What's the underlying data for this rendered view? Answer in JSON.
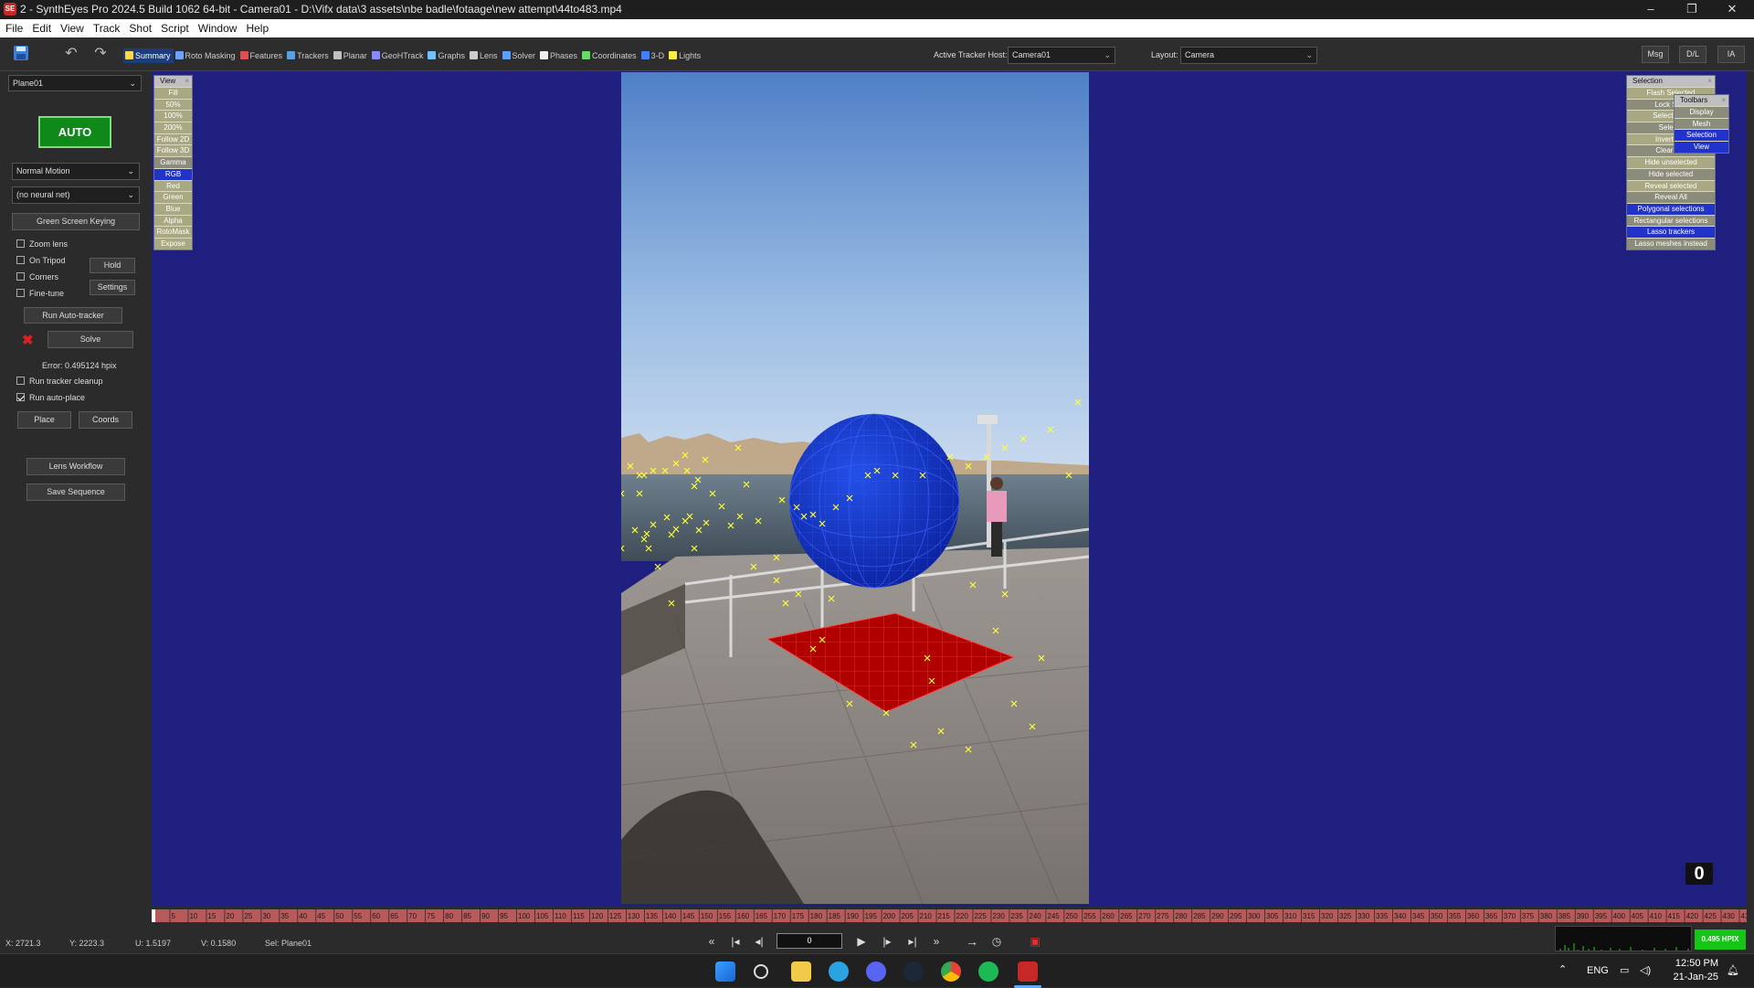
{
  "window": {
    "title": "2 - SynthEyes Pro 2024.5 Build 1062 64-bit - Camera01 - D:\\Vifx data\\3 assets\\nbe badle\\fotaage\\new attempt\\44to483.mp4",
    "app_icon_text": "SE",
    "controls": {
      "minimize": "–",
      "maximize": "❐",
      "close": "✕"
    }
  },
  "menu": [
    "File",
    "Edit",
    "View",
    "Track",
    "Shot",
    "Script",
    "Window",
    "Help"
  ],
  "toolbar": {
    "rooms": [
      {
        "label": "Summary",
        "color": "#ffd84a",
        "active": true
      },
      {
        "label": "Roto Masking",
        "color": "#6ea0ff"
      },
      {
        "label": "Features",
        "color": "#e05050"
      },
      {
        "label": "Trackers",
        "color": "#58a0e0"
      },
      {
        "label": "Planar",
        "color": "#c0c0c0"
      },
      {
        "label": "GeoHTrack",
        "color": "#8a8aff"
      },
      {
        "label": "Graphs",
        "color": "#70c0ff"
      },
      {
        "label": "Lens",
        "color": "#cccccc"
      },
      {
        "label": "Solver",
        "color": "#5aa0ff"
      },
      {
        "label": "Phases",
        "color": "#eeeeee"
      },
      {
        "label": "Coordinates",
        "color": "#66dd66"
      },
      {
        "label": "3-D",
        "color": "#4080ff"
      },
      {
        "label": "Lights",
        "color": "#ffee44"
      }
    ],
    "tracker_host_label": "Active Tracker Host:",
    "tracker_host_value": "Camera01",
    "layout_label": "Layout:",
    "layout_value": "Camera",
    "right_buttons": [
      "Msg",
      "D/L",
      "IA"
    ]
  },
  "left_panel": {
    "object_select": "Plane01",
    "auto_button": "AUTO",
    "motion_select": "Normal Motion",
    "neural_select": "(no neural net)",
    "green_screen": "Green Screen Keying",
    "checkboxes": [
      {
        "label": "Zoom lens",
        "checked": false
      },
      {
        "label": "On Tripod",
        "checked": false
      },
      {
        "label": "Corners",
        "checked": false
      },
      {
        "label": "Fine-tune",
        "checked": false
      }
    ],
    "hold": "Hold",
    "settings": "Settings",
    "run_auto_tracker": "Run Auto-tracker",
    "solve": "Solve",
    "error_text": "Error: 0.495124 hpix",
    "cleanup": {
      "label": "Run tracker cleanup",
      "checked": false
    },
    "autoplace": {
      "label": "Run auto-place",
      "checked": true
    },
    "place": "Place",
    "coords": "Coords",
    "lens_workflow": "Lens Workflow",
    "save_sequence": "Save Sequence"
  },
  "view_menu": {
    "title": "View",
    "items": [
      "Fill",
      "50%",
      "100%",
      "200%",
      "Follow 2D",
      "Follow 3D",
      "Gamma",
      "RGB",
      "Red",
      "Green",
      "Blue",
      "Alpha",
      "RotoMask",
      "Expose"
    ],
    "highlighted": "RGB"
  },
  "selection_menu": {
    "title": "Selection",
    "items": [
      "Flash Selected",
      "Lock Se...",
      "Select sa...",
      "Selec...",
      "Invert S...",
      "Clear S...",
      "Hide unselected",
      "Hide selected",
      "Reveal selected",
      "Reveal All",
      "Polygonal selections",
      "Rectangular selections",
      "Lasso trackers",
      "Lasso meshes instead"
    ],
    "blue_items": [
      "Polygonal selections",
      "Lasso trackers"
    ]
  },
  "toolbars_menu": {
    "title": "Toolbars",
    "items": [
      "Display",
      "Mesh",
      "Selection",
      "View"
    ],
    "blue_items": [
      "Selection",
      "View"
    ]
  },
  "frame_number": "0",
  "timeline": {
    "ticks": [
      "5",
      "10",
      "15",
      "20",
      "25",
      "30",
      "35",
      "40",
      "45",
      "50",
      "55",
      "60",
      "65",
      "70",
      "75",
      "80",
      "85",
      "90",
      "95",
      "100",
      "105",
      "110",
      "115",
      "120",
      "125",
      "130",
      "135",
      "140",
      "145",
      "150",
      "155",
      "160",
      "165",
      "170",
      "175",
      "180",
      "185",
      "190",
      "195",
      "200",
      "205",
      "210",
      "215",
      "220",
      "225",
      "230",
      "235",
      "240",
      "245",
      "250",
      "255",
      "260",
      "265",
      "270",
      "275",
      "280",
      "285",
      "290",
      "295",
      "300",
      "305",
      "310",
      "315",
      "320",
      "325",
      "330",
      "335",
      "340",
      "345",
      "350",
      "355",
      "360",
      "365",
      "370",
      "375",
      "380",
      "385",
      "390",
      "395",
      "400",
      "405",
      "410",
      "415",
      "420",
      "425",
      "430",
      "435"
    ],
    "max_frame": 437
  },
  "statusbar": {
    "x": "X:  2721.3",
    "y": "Y:  2223.3",
    "u": "U:  1.5197",
    "v": "V:  0.1580",
    "sel": "Sel: Plane01",
    "current_frame": "0",
    "error_badge": "0.495 HPIX"
  },
  "taskbar": {
    "lang": "ENG",
    "time": "12:50 PM",
    "date": "21-Jan-25"
  },
  "colors": {
    "viewport_bg": "#1f1f80",
    "auto_green": "#0f8a1a",
    "sphere_blue": "#1233c8",
    "plane_red": "#b00000",
    "tracker_yellow": "#ffff33"
  },
  "trackers": [
    [
      680,
      540
    ],
    [
      690,
      510
    ],
    [
      700,
      520
    ],
    [
      705,
      520
    ],
    [
      715,
      515
    ],
    [
      728,
      515
    ],
    [
      740,
      507
    ],
    [
      750,
      498
    ],
    [
      752,
      515
    ],
    [
      764,
      525
    ],
    [
      780,
      540
    ],
    [
      640,
      565
    ],
    [
      760,
      532
    ],
    [
      772,
      503
    ],
    [
      808,
      490
    ],
    [
      817,
      530
    ],
    [
      700,
      540
    ],
    [
      695,
      580
    ],
    [
      708,
      584
    ],
    [
      715,
      574
    ],
    [
      730,
      566
    ],
    [
      740,
      579
    ],
    [
      750,
      570
    ],
    [
      755,
      565
    ],
    [
      765,
      580
    ],
    [
      773,
      572
    ],
    [
      790,
      554
    ],
    [
      800,
      575
    ],
    [
      810,
      565
    ],
    [
      830,
      570
    ],
    [
      856,
      547
    ],
    [
      872,
      555
    ],
    [
      880,
      565
    ],
    [
      890,
      563
    ],
    [
      900,
      573
    ],
    [
      915,
      555
    ],
    [
      930,
      545
    ],
    [
      950,
      520
    ],
    [
      960,
      515
    ],
    [
      980,
      520
    ],
    [
      1010,
      520
    ],
    [
      1040,
      500
    ],
    [
      1060,
      510
    ],
    [
      1080,
      500
    ],
    [
      1100,
      490
    ],
    [
      1120,
      480
    ],
    [
      1150,
      470
    ],
    [
      1180,
      440
    ],
    [
      1170,
      520
    ],
    [
      680,
      600
    ],
    [
      705,
      590
    ],
    [
      710,
      600
    ],
    [
      720,
      620
    ],
    [
      735,
      585
    ],
    [
      760,
      600
    ],
    [
      850,
      610
    ],
    [
      825,
      620
    ],
    [
      850,
      635
    ],
    [
      874,
      650
    ],
    [
      900,
      700
    ],
    [
      910,
      655
    ],
    [
      930,
      770
    ],
    [
      970,
      780
    ],
    [
      1000,
      815
    ],
    [
      1015,
      720
    ],
    [
      1030,
      800
    ],
    [
      1060,
      820
    ],
    [
      1090,
      690
    ],
    [
      1110,
      770
    ],
    [
      1130,
      795
    ],
    [
      1140,
      720
    ],
    [
      735,
      660
    ],
    [
      860,
      660
    ],
    [
      890,
      710
    ],
    [
      1065,
      640
    ],
    [
      1020,
      745
    ],
    [
      1100,
      650
    ]
  ]
}
